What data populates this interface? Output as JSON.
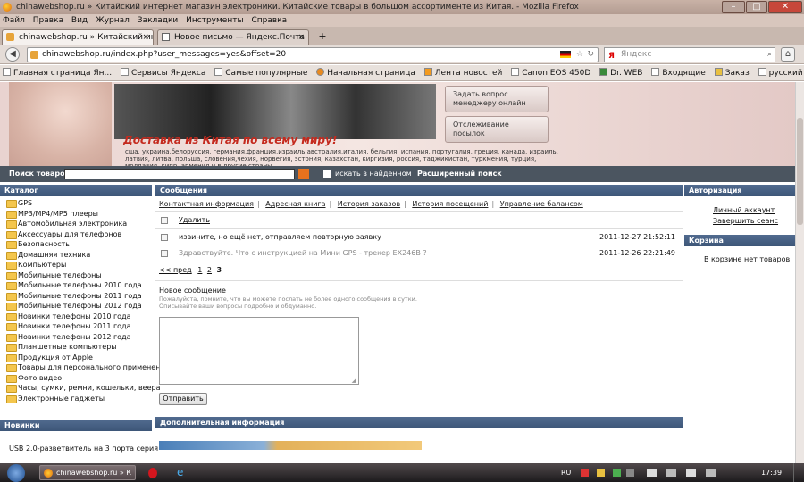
{
  "window": {
    "title": "chinawebshop.ru » Китайский интернет магазин электроники. Китайские товары в большом ассортименте из Китая. - Mozilla Firefox"
  },
  "menu": [
    "Файл",
    "Правка",
    "Вид",
    "Журнал",
    "Закладки",
    "Инструменты",
    "Справка"
  ],
  "tabs": [
    {
      "label": "chinawebshop.ru » Китайский интер...",
      "close": "×"
    },
    {
      "label": "Новое письмо — Яндекс.Почта",
      "close": "×"
    }
  ],
  "new_tab": "+",
  "url": "chinawebshop.ru/index.php?user_messages=yes&offset=20",
  "search_placeholder": "Яндекс",
  "bookmarks": [
    "Главная страница Ян...",
    "Сервисы Яндекса",
    "Самые популярные",
    "Начальная страница",
    "Лента новостей",
    "Canon EOS 450D",
    "Dr. WEB",
    "Входящие",
    "Заказ",
    "русский"
  ],
  "banner": {
    "slogan": "Доставка из Китая по всему миру!",
    "countries": "сша, украина,белоруссия, германия,франция,израиль,австралия,италия, бельгия, испания, португалия, греция, канада, израиль, латвия, литва, польша, словения,чехия, норвегия, эстония, казахстан, киргизия, россия, таджикистан, туркмения, турция, молдавия, кипр, армения,и в другие страны.",
    "btn_manager": "Задать вопрос менеджеру онлайн",
    "btn_tracking": "Отслеживание посылок"
  },
  "searchbar": {
    "label": "Поиск товаров",
    "in_found": "искать в найденном",
    "advanced": "Расширенный поиск"
  },
  "catalog": {
    "title": "Каталог",
    "items": [
      "GPS",
      "MP3/MP4/MP5 плееры",
      "Автомобильная электроника",
      "Аксессуары для телефонов",
      "Безопасность",
      "Домашняя техника",
      "Компьютеры",
      "Мобильные телефоны",
      "Мобильные телефоны 2010 года",
      "Мобильные телефоны 2011 года",
      "Мобильные телефоны 2012 года",
      "Новинки телефоны 2010 года",
      "Новинки телефоны 2011 года",
      "Новинки телефоны 2012 года",
      "Планшетные компьютеры",
      "Продукция от Apple",
      "Товары для персонального применения",
      "Фото видео",
      "Часы, сумки, ремни, кошельки, веера",
      "Электронные гаджеты"
    ]
  },
  "news": {
    "title": "Новинки",
    "item": "USB 2.0-разветвитель на 3 порта серия"
  },
  "messages": {
    "title": "Сообщения",
    "subtabs": [
      "Контактная информация",
      "Адресная книга",
      "История заказов",
      "История посещений",
      "Управление балансом"
    ],
    "delete": "Удалить",
    "rows": [
      {
        "text": "извините, но ещё нет, отправляем повторную заявку",
        "date": "2011-12-27 21:52:11"
      },
      {
        "text": "Здравствуйте. Что с инструкцией на Мини GPS - трекер EX246B ?",
        "date": "2011-12-26 22:21:49"
      }
    ],
    "pager": {
      "prev": "<< пред",
      "pages": [
        "1",
        "2"
      ],
      "current": "3"
    },
    "new_title": "Новое сообщение",
    "hint1": "Пожалуйста, помните, что вы можете послать не более одного сообщения в сутки.",
    "hint2": "Описывайте ваши вопросы подробно и обдуманно.",
    "send": "Отправить",
    "extra": "Дополнительная информация"
  },
  "auth": {
    "title": "Авторизация",
    "account": "Личный аккаунт",
    "logout": "Завершить сеанс"
  },
  "cart": {
    "title": "Корзина",
    "empty": "В корзине нет товаров"
  },
  "taskbar": {
    "task": "chinawebshop.ru » К",
    "lang": "RU",
    "time": "17:39"
  }
}
